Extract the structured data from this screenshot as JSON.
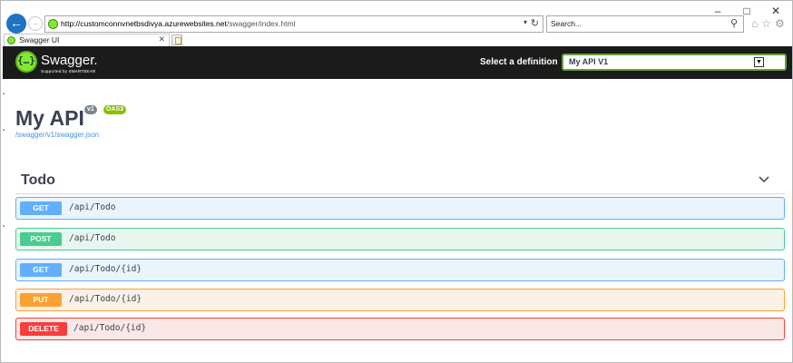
{
  "browser": {
    "window_controls": [
      "–",
      "□",
      "✕"
    ],
    "url_host": "http://customconnvnetbsdivya.azurewebsites.net",
    "url_path": "/swagger/index.html",
    "search_placeholder": "Search...",
    "tab_title": "Swagger UI"
  },
  "topbar": {
    "brand": "Swagger.",
    "brand_sub": "Supported by SMARTBEAR",
    "logo_glyph": "{…}",
    "definition_label": "Select a definition",
    "definition_value": "My API V1"
  },
  "info": {
    "title": "My API",
    "version_badge": "v1",
    "oas_badge": "OAS3",
    "spec_link": "/swagger/v1/swagger.json"
  },
  "tag": {
    "name": "Todo"
  },
  "operations": [
    {
      "method": "GET",
      "path": "/api/Todo"
    },
    {
      "method": "POST",
      "path": "/api/Todo"
    },
    {
      "method": "GET",
      "path": "/api/Todo/{id}"
    },
    {
      "method": "PUT",
      "path": "/api/Todo/{id}"
    },
    {
      "method": "DELETE",
      "path": "/api/Todo/{id}"
    }
  ],
  "colors": {
    "get": "#61affe",
    "post": "#49cc90",
    "put": "#fca130",
    "delete": "#f93e3e",
    "topbar": "#1b1b1b",
    "accent": "#85ea2d"
  }
}
